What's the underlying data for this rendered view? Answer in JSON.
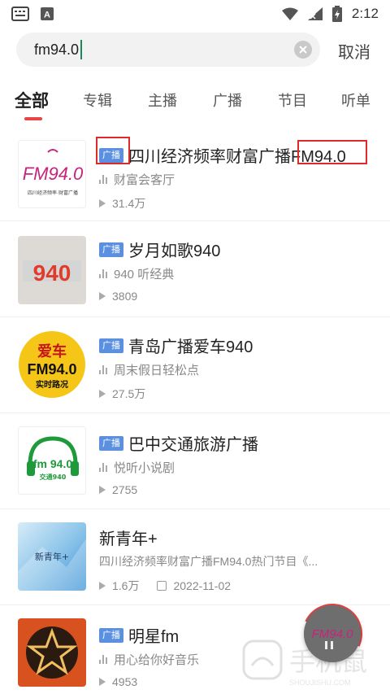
{
  "status_bar": {
    "time": "2:12"
  },
  "search": {
    "value": "fm94.0",
    "cancel_label": "取消"
  },
  "tabs": [
    {
      "label": "全部",
      "active": true
    },
    {
      "label": "专辑"
    },
    {
      "label": "主播"
    },
    {
      "label": "广播"
    },
    {
      "label": "节目"
    },
    {
      "label": "听单"
    }
  ],
  "results": [
    {
      "badge": "广播",
      "title_main": "四川经济频率财富广播",
      "title_hl": "FM94.0",
      "subtitle": "财富会客厅",
      "plays": "31.4万",
      "cover_text": "FM94.0",
      "cover_caption": "四川经济频率·财富广播"
    },
    {
      "badge": "广播",
      "title_main": "岁月如歌940",
      "subtitle": "940 听经典",
      "plays": "3809",
      "cover_text": "940"
    },
    {
      "badge": "广播",
      "title_main": "青岛广播爱车940",
      "subtitle": "周末假日轻松点",
      "plays": "27.5万",
      "cover_text_top": "爱车",
      "cover_text_mid": "FM94.0",
      "cover_text_bot": "实时路况"
    },
    {
      "badge": "广播",
      "title_main": "巴中交通旅游广播",
      "subtitle": "悦听小说剧",
      "plays": "2755",
      "cover_text": "fm 94.0",
      "cover_caption": "交通940"
    },
    {
      "title_main": "新青年+",
      "subtitle": "四川经济频率财富广播FM94.0热门节目《...",
      "plays": "1.6万",
      "date": "2022-11-02",
      "cover_text": "新青年+"
    },
    {
      "badge": "广播",
      "title_main": "明星fm",
      "subtitle": "用心给你好音乐",
      "plays": "4953"
    }
  ],
  "floating_player": {
    "cover_text": "FM94.0"
  },
  "watermark": {
    "text": "手机鼠",
    "sub": "SHOUJISHU.COM"
  },
  "colors": {
    "accent": "#e84545",
    "badge": "#5b8fe0",
    "highlight": "#e02a2a"
  }
}
